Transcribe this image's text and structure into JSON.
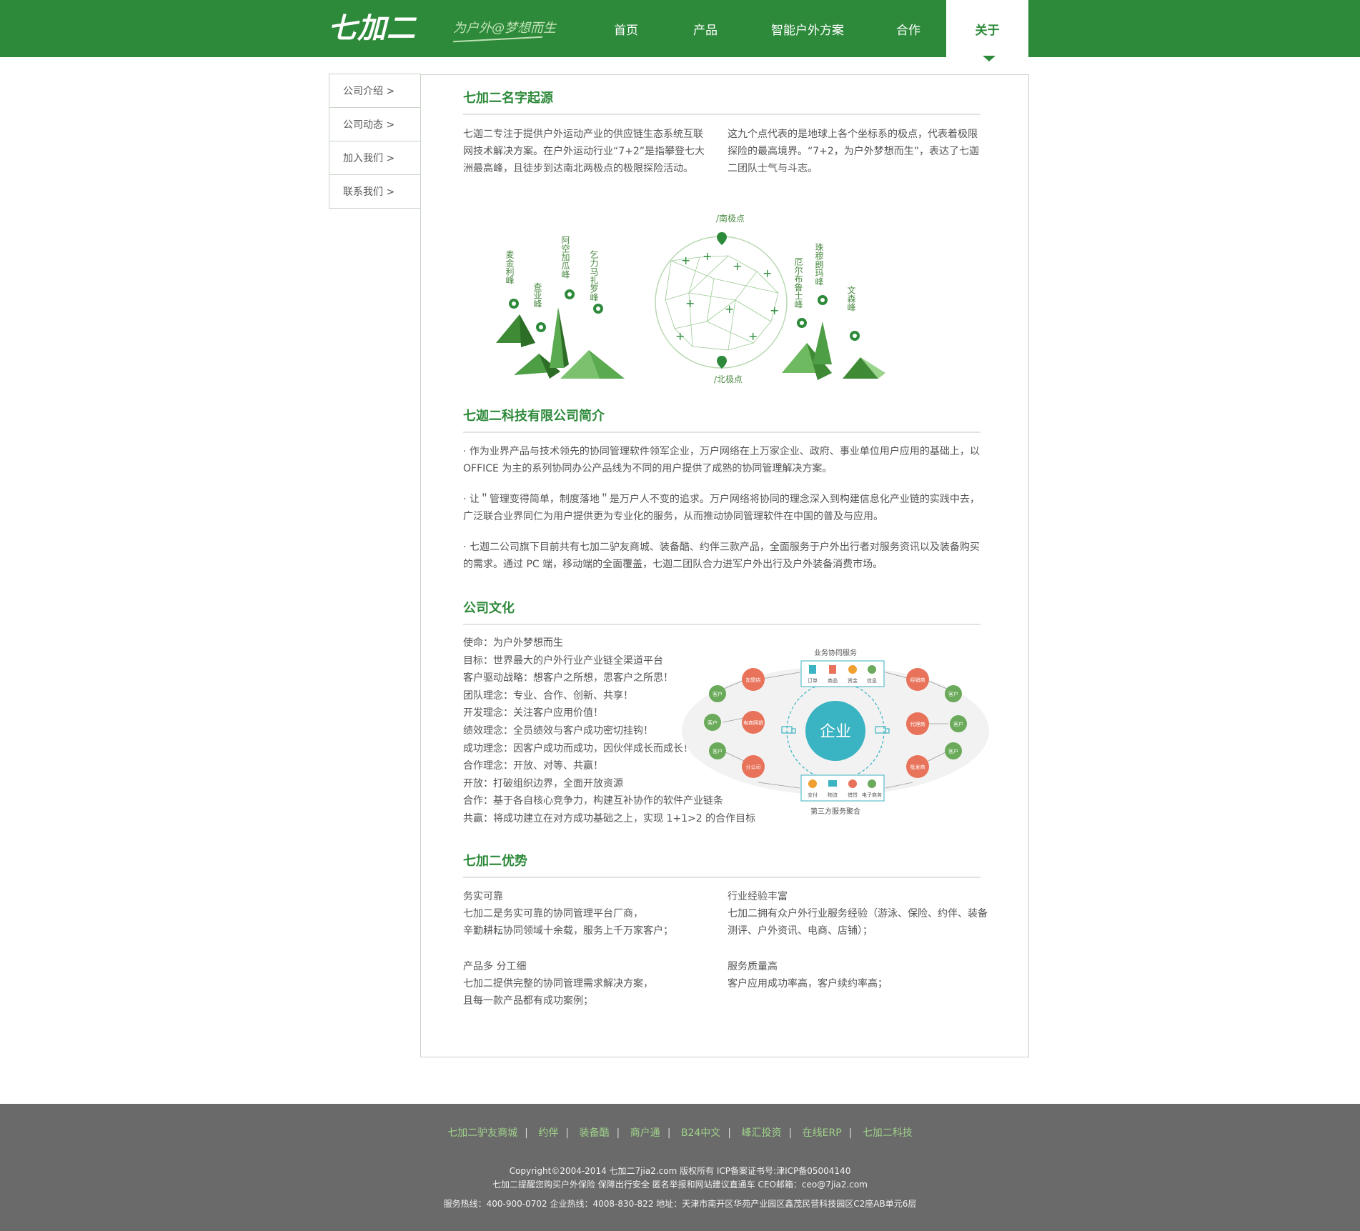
{
  "header": {
    "logo_text": "七加二",
    "slogan": "为户外@梦想而生",
    "nav": [
      {
        "label": "首页"
      },
      {
        "label": "产品"
      },
      {
        "label": "智能户外方案"
      },
      {
        "label": "合作"
      },
      {
        "label": "关于",
        "active": true
      }
    ]
  },
  "sidebar": {
    "items": [
      {
        "label": "公司介绍 >"
      },
      {
        "label": "公司动态 >"
      },
      {
        "label": "加入我们 >"
      },
      {
        "label": "联系我们 >"
      }
    ]
  },
  "origin": {
    "title": "七加二名字起源",
    "left_lines": [
      "七迦二专注于提供户外运动产业的供应链生态系统互联",
      "网技术解决方案。在户外运动行业“7+2”是指攀登七大",
      "洲最高峰，且徒步到达南北两极点的极限探险活动。"
    ],
    "right_lines": [
      "这九个点代表的是地球上各个坐标系的极点，代表着极限",
      "探险的最高境界。“7+2，为户外梦想而生”，表达了七迦",
      "二团队士气与斗志。"
    ],
    "illustration": {
      "south_pole": "/南极点",
      "north_pole": "/北极点",
      "peaks": [
        "麦金利峰",
        "查亚峰",
        "阿空加瓜峰",
        "乞力马扎罗峰",
        "厄尔布鲁士峰",
        "珠穆朗玛峰",
        "文森峰"
      ]
    }
  },
  "intro": {
    "title": "七迦二科技有限公司简介",
    "paragraphs": [
      [
        "· 作为业界产品与技术领先的协同管理软件领军企业，万户网络在上万家企业、政府、事业单位用户应用的基础上，以",
        "OFFICE 为主的系列协同办公产品线为不同的用户提供了成熟的协同管理解决方案。"
      ],
      [
        "· 让＂管理变得简单，制度落地＂是万户人不变的追求。万户网络将协同的理念深入到构建信息化产业链的实践中去，",
        "广泛联合业界同仁为用户提供更为专业化的服务，从而推动协同管理软件在中国的普及与应用。"
      ],
      [
        "· 七迦二公司旗下目前共有七加二驴友商城、装备酷、约伴三款产品，全面服务于户外出行者对服务资讯以及装备购买",
        "的需求。通过 PC 端，移动端的全面覆盖，七迦二团队合力进军户外出行及户外装备消费市场。"
      ]
    ]
  },
  "culture": {
    "title": "公司文化",
    "lines": [
      "使命：为户外梦想而生",
      "目标：世界最大的户外行业产业链全渠道平台",
      "客户驱动战略：想客户之所想，思客户之所思！",
      "团队理念：专业、合作、创新、共享！",
      "开发理念：关注客户应用价值！",
      "绩效理念：全员绩效与客户成功密切挂钩！",
      "成功理念：因客户成功而成功，因伙伴成长而成长！",
      "合作理念：开放、对等、共赢！",
      "开放：打破组织边界，全面开放资源",
      "合作：基于各自核心竞争力，构建互补协作的软件产业链条",
      "共赢：将成功建立在对方成功基础之上，实现 1+1>2 的合作目标"
    ],
    "diagram": {
      "center": "企业",
      "top_box_title": "业务协同服务",
      "top_box_items": [
        "订单",
        "商品",
        "资金",
        "信息"
      ],
      "bottom_box_title": "第三方服务聚合",
      "bottom_box_items": [
        "支付",
        "物流",
        "借贷",
        "电子商务"
      ],
      "left_nodes": [
        "加盟店",
        "电商网销",
        "分公司"
      ],
      "right_nodes": [
        "经销商",
        "代理商",
        "批发商"
      ],
      "customer_label": "客户",
      "colors": {
        "accent_green": "#2e8a3b",
        "node_red": "#e8735a",
        "node_green": "#6aaa5a",
        "center_teal": "#3ab3c2"
      }
    }
  },
  "advantages": {
    "title": "七加二优势",
    "blocks": [
      {
        "heading": "务实可靠",
        "lines": [
          "七加二是务实可靠的协同管理平台厂商，",
          "辛勤耕耘协同领域十余载，服务上千万家客户；"
        ]
      },
      {
        "heading": "行业经验丰富",
        "lines": [
          "七加二拥有众户外行业服务经验（游泳、保险、约伴、装备",
          "测评、户外资讯、电商、店铺）；"
        ]
      },
      {
        "heading": "产品多 分工细",
        "lines": [
          "七加二提供完整的协同管理需求解决方案，",
          "且每一款产品都有成功案例；"
        ]
      },
      {
        "heading": "服务质量高",
        "lines": [
          "客户应用成功率高，客户续约率高；"
        ]
      }
    ]
  },
  "footer": {
    "links": [
      "七加二驴友商城",
      "约伴",
      "装备酷",
      "商户通",
      "B24中文",
      "峰汇投资",
      "在线ERP",
      "七加二科技"
    ],
    "copyright": "Copyright©2004-2014  七加二7jia2.com 版权所有  ICP备案证书号:津ICP备05004140",
    "notice": "七加二提醒您购买户外保险 保障出行安全 匿名举报和网站建议直通车 CEO邮箱：ceo@7jia2.com",
    "contact": "服务热线：400-900-0702    企业热线：4008-830-822    地址：天津市南开区华苑产业园区鑫茂民营科技园区C2座AB单元6层"
  }
}
